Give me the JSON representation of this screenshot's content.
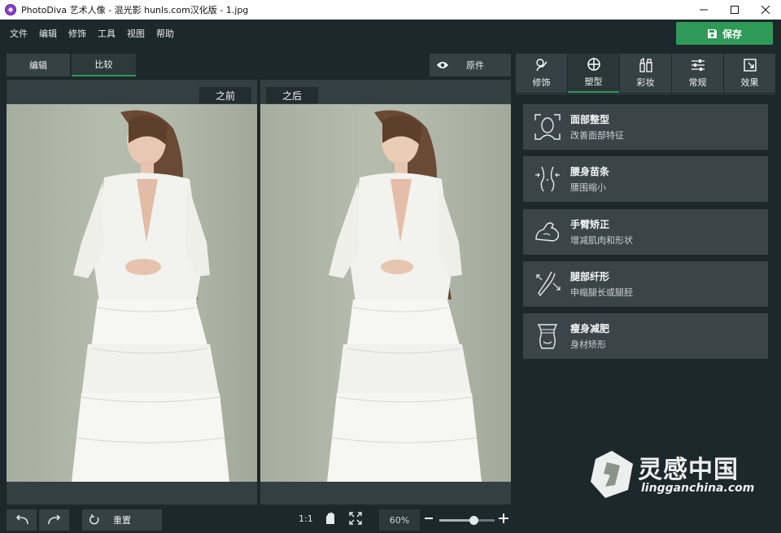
{
  "window": {
    "title": "PhotoDiva 艺术人像 - 混光影 hunls.com汉化版 - 1.jpg",
    "controls": [
      "minimize",
      "maximize",
      "close"
    ]
  },
  "menu": [
    "文件",
    "编辑",
    "修饰",
    "工具",
    "视图",
    "帮助"
  ],
  "save_label": "保存",
  "view_tabs": [
    {
      "label": "编辑",
      "active": false
    },
    {
      "label": "比较",
      "active": true
    }
  ],
  "original_label": "原件",
  "viewers": {
    "before_label": "之前",
    "after_label": "之后"
  },
  "right_tabs": [
    {
      "label": "修饰",
      "icon": "retouch-icon",
      "active": false
    },
    {
      "label": "塑型",
      "icon": "reshape-icon",
      "active": true
    },
    {
      "label": "彩妆",
      "icon": "makeup-icon",
      "active": false
    },
    {
      "label": "常规",
      "icon": "sliders-icon",
      "active": false
    },
    {
      "label": "效果",
      "icon": "effects-icon",
      "active": false
    }
  ],
  "tools": [
    {
      "name": "面部整型",
      "desc": "改善面部特征",
      "icon": "face-icon"
    },
    {
      "name": "腰身苗条",
      "desc": "腰围缩小",
      "icon": "waist-icon"
    },
    {
      "name": "手臂矫正",
      "desc": "增减肌肉和形状",
      "icon": "arm-icon"
    },
    {
      "name": "腿部纤形",
      "desc": "申缩腿长或腿胫",
      "icon": "leg-icon"
    },
    {
      "name": "瘦身减肥",
      "desc": "身材矫形",
      "icon": "body-icon"
    }
  ],
  "bottom": {
    "reset_label": "重置",
    "ratio_label": "1:1",
    "zoom_value": "60%",
    "zoom_fraction": 0.62
  },
  "watermark": {
    "cn": "灵感中国",
    "en": "lingganchina.com"
  },
  "colors": {
    "accent": "#2f9a57",
    "background": "#1d282c",
    "panel": "#354145"
  }
}
